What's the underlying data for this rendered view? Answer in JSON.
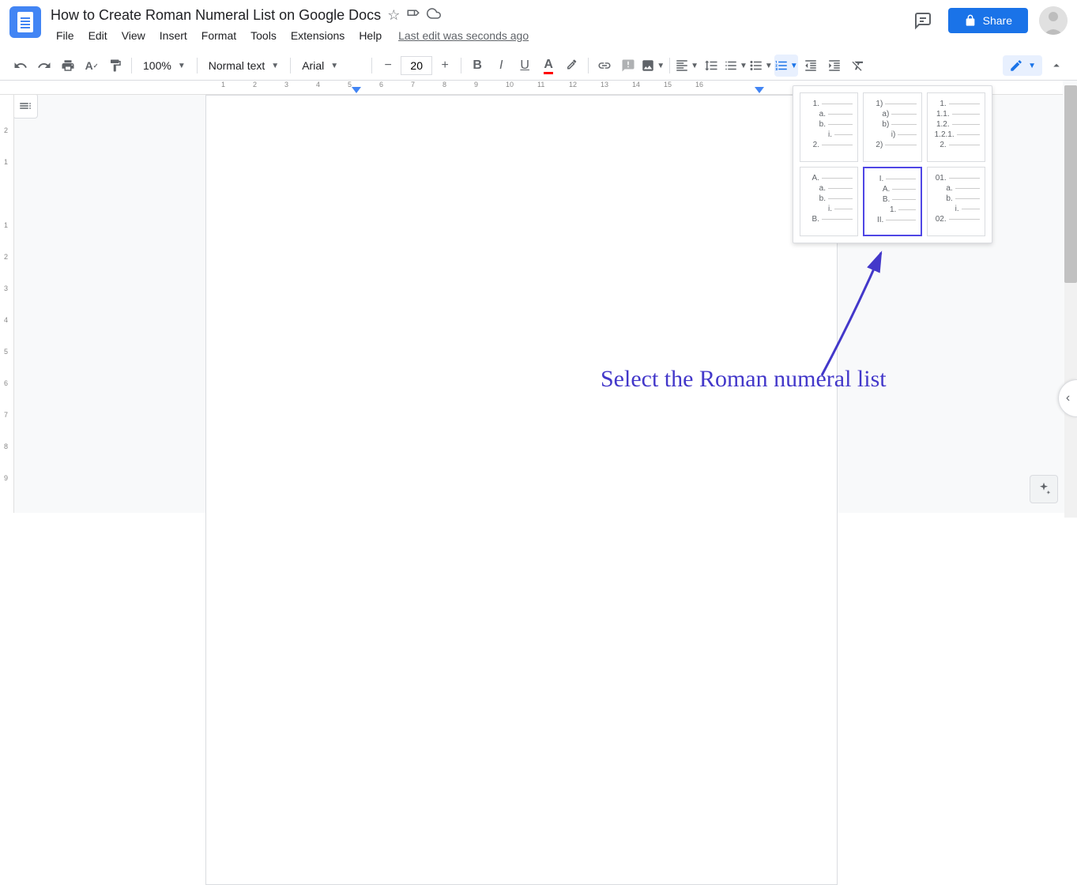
{
  "document": {
    "title": "How to Create Roman Numeral List on Google Docs",
    "last_edit": "Last edit was seconds ago"
  },
  "menus": {
    "file": "File",
    "edit": "Edit",
    "view": "View",
    "insert": "Insert",
    "format": "Format",
    "tools": "Tools",
    "extensions": "Extensions",
    "help": "Help"
  },
  "share": {
    "label": "Share"
  },
  "toolbar": {
    "zoom": "100%",
    "style": "Normal text",
    "font": "Arial",
    "size": "20"
  },
  "list_options": {
    "opt1": [
      "1.",
      "a.",
      "b.",
      "i.",
      "2."
    ],
    "opt2": [
      "1)",
      "a)",
      "b)",
      "i)",
      "2)"
    ],
    "opt3": [
      "1.",
      "1.1.",
      "1.2.",
      "1.2.1.",
      "2."
    ],
    "opt4": [
      "A.",
      "a.",
      "b.",
      "i.",
      "B."
    ],
    "opt5": [
      "I.",
      "A.",
      "B.",
      "1.",
      "II."
    ],
    "opt6": [
      "01.",
      "a.",
      "b.",
      "i.",
      "02."
    ]
  },
  "annotation": {
    "text": "Select the Roman numeral list"
  }
}
